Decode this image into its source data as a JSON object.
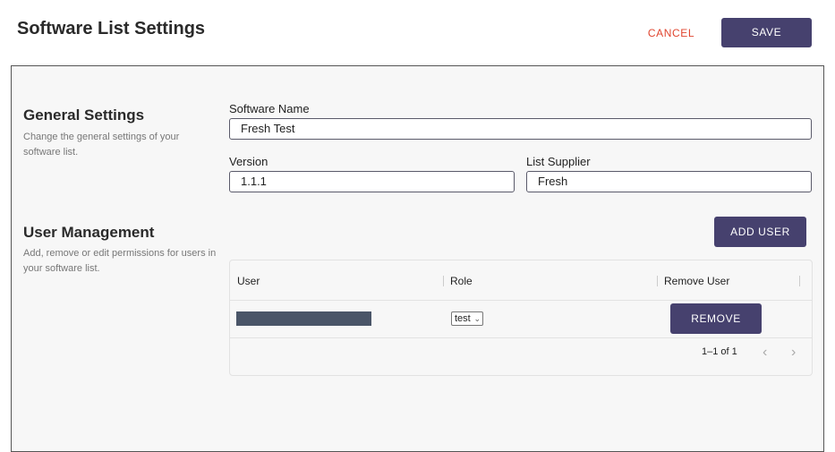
{
  "header": {
    "title": "Software List Settings",
    "cancel_label": "CANCEL",
    "save_label": "SAVE"
  },
  "general": {
    "title": "General Settings",
    "description": "Change the general settings of your software list.",
    "software_name_label": "Software Name",
    "software_name_value": "Fresh Test",
    "version_label": "Version",
    "version_value": "1.1.1",
    "supplier_label": "List Supplier",
    "supplier_value": "Fresh"
  },
  "users": {
    "title": "User Management",
    "description": "Add, remove or edit permissions for users in your software list.",
    "add_user_label": "ADD USER",
    "columns": [
      "User",
      "Role",
      "Remove User"
    ],
    "rows": [
      {
        "user": "",
        "role": "test",
        "remove_label": "REMOVE"
      }
    ],
    "pagination": "1–1 of 1"
  },
  "icons": {
    "prev": "chevron-left-icon",
    "next": "chevron-right-icon",
    "dropdown": "chevron-down-icon"
  },
  "colors": {
    "primary": "#46416e",
    "cancel": "#e0452f",
    "redacted": "#4a5568"
  }
}
